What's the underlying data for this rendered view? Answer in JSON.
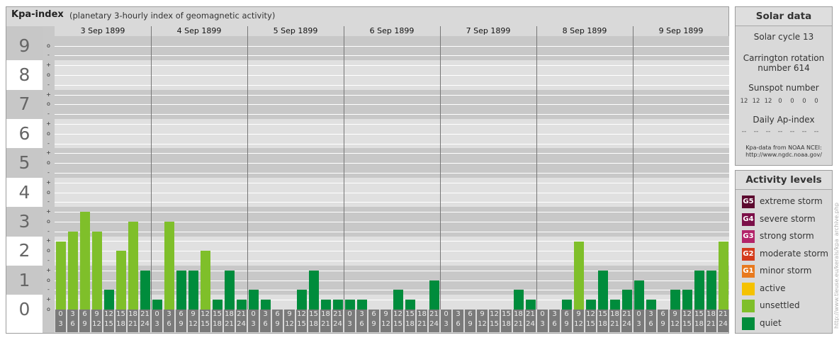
{
  "title": "Kpa-index",
  "subtitle": "(planetary 3-hourly index of geomagnetic activity)",
  "chart_data": {
    "type": "bar",
    "y_levels": [
      "0",
      "1",
      "2",
      "3",
      "4",
      "5",
      "6",
      "7",
      "8",
      "9"
    ],
    "y_minor_marks": [
      "o",
      "-",
      "+"
    ],
    "ylim": [
      0,
      9.33
    ],
    "days": [
      "3 Sep 1899",
      "4 Sep 1899",
      "5 Sep 1899",
      "6 Sep 1899",
      "7 Sep 1899",
      "8 Sep 1899",
      "9 Sep 1899"
    ],
    "hour_starts": [
      "0",
      "3",
      "6",
      "9",
      "12",
      "15",
      "18",
      "21"
    ],
    "hour_ends": [
      "3",
      "6",
      "9",
      "12",
      "15",
      "18",
      "21",
      "24"
    ],
    "values": [
      [
        2.33,
        2.67,
        3.33,
        2.67,
        0.67,
        2.0,
        3.0,
        1.33
      ],
      [
        0.33,
        3.0,
        1.33,
        1.33,
        2.0,
        0.33,
        1.33,
        0.33
      ],
      [
        0.67,
        0.33,
        0.0,
        0.0,
        0.67,
        1.33,
        0.33,
        0.33
      ],
      [
        0.33,
        0.33,
        0.0,
        0.0,
        0.67,
        0.33,
        0.0,
        1.0
      ],
      [
        0.0,
        0.0,
        0.0,
        0.0,
        0.0,
        0.0,
        0.67,
        0.33
      ],
      [
        0.0,
        0.0,
        0.33,
        2.33,
        0.33,
        1.33,
        0.33,
        0.67
      ],
      [
        1.0,
        0.33,
        0.0,
        0.67,
        0.67,
        1.33,
        1.33,
        2.33
      ]
    ],
    "colors": {
      "quiet": "#008c3c",
      "unsettled": "#7fbf2a"
    }
  },
  "solar": {
    "head": "Solar data",
    "cycle": "Solar cycle 13",
    "carrington_1": "Carrington rotation",
    "carrington_2": "number 614",
    "sunspot_label": "Sunspot number",
    "sunspots": [
      "12",
      "12",
      "12",
      "0",
      "0",
      "0",
      "0"
    ],
    "ap_label": "Daily Ap-index",
    "ap": [
      "--",
      "--",
      "--",
      "--",
      "--",
      "--",
      "--"
    ],
    "source_1": "Kpa-data from NOAA NCEI:",
    "source_2": "http://www.ngdc.noaa.gov/"
  },
  "activity": {
    "head": "Activity levels",
    "levels": [
      {
        "tag": "G5",
        "label": "extreme storm",
        "color": "#5c0a2f"
      },
      {
        "tag": "G4",
        "label": "severe storm",
        "color": "#7b0f48"
      },
      {
        "tag": "G3",
        "label": "strong storm",
        "color": "#b3246a"
      },
      {
        "tag": "G2",
        "label": "moderate storm",
        "color": "#d43b1c"
      },
      {
        "tag": "G1",
        "label": "minor storm",
        "color": "#e8791e"
      },
      {
        "tag": "",
        "label": "active",
        "color": "#f5c200"
      },
      {
        "tag": "",
        "label": "unsettled",
        "color": "#7fbf2a"
      },
      {
        "tag": "",
        "label": "quiet",
        "color": "#008c3c"
      }
    ]
  },
  "watermark": "http://www.tieuse.eu/kerals/kpa_archive.php"
}
